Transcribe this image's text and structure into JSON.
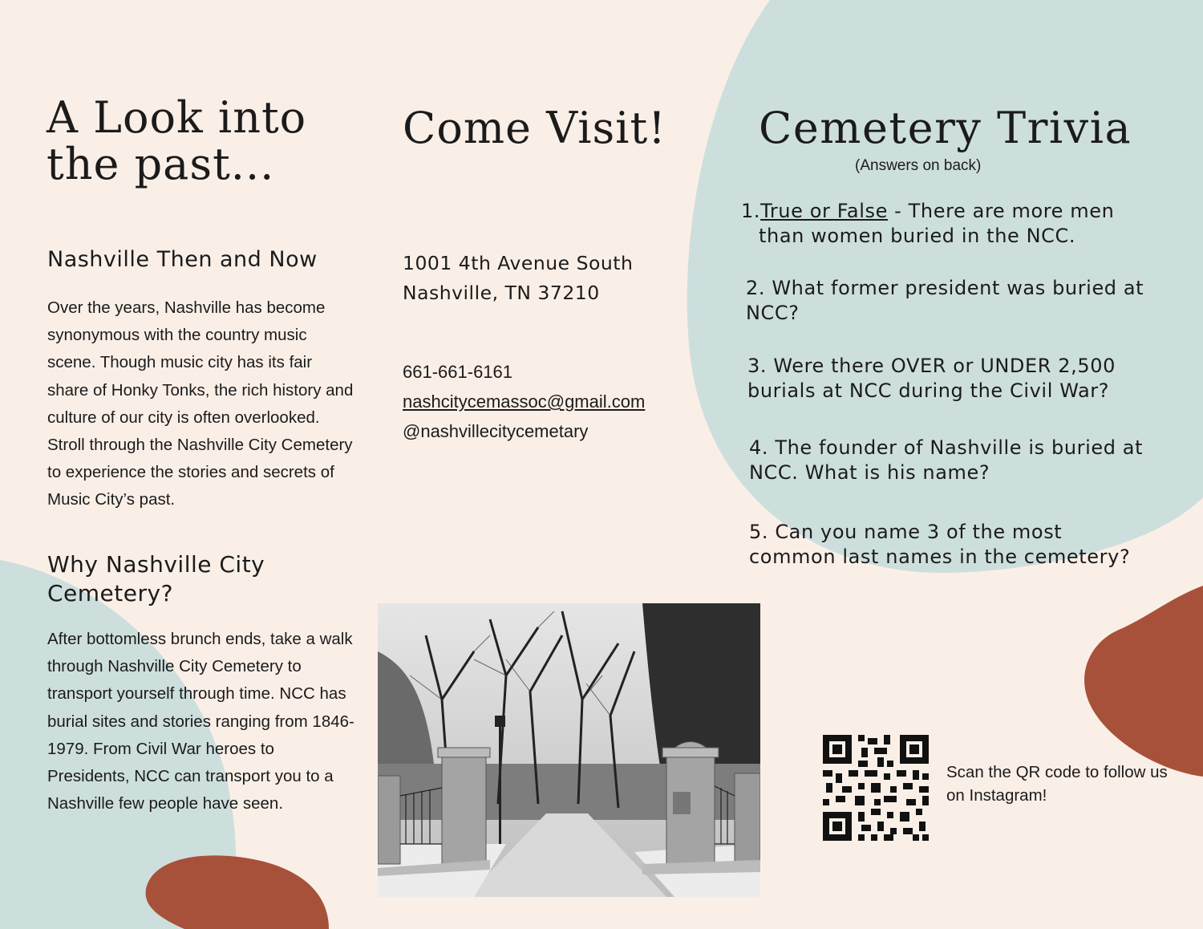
{
  "colors": {
    "background": "#faefe7",
    "blue_blob": "#cddfdd",
    "rust_blob": "#a8513a",
    "text": "#1b1b1b"
  },
  "col1": {
    "title_line1": "A Look into",
    "title_line2": "the past...",
    "heading1": "Nashville Then and Now",
    "para1": "Over the years, Nashville has become synonymous with the country music scene. Though music city has its fair share of Honky Tonks, the rich history and culture of our city is often overlooked. Stroll through the Nashville City Cemetery to experience the stories and secrets of Music City’s past.",
    "heading2": "Why Nashville City Cemetery?",
    "para2": "After bottomless brunch ends, take a walk through Nashville City Cemetery to transport yourself through time. NCC has burial sites and stories ranging from 1846-1979. From Civil War heroes to Presidents, NCC can transport you to a Nashville few people have seen."
  },
  "col2": {
    "title": "Come Visit!",
    "address_line1": "1001 4th Avenue South",
    "address_line2": "Nashville, TN 37210",
    "phone": "661-661-6161",
    "email": "nashcitycemassoc@gmail.com",
    "instagram": "@nashvillecitycemetary"
  },
  "photo": {
    "icon": "cemetery-gate-photo"
  },
  "col3": {
    "title": "Cemetery Trivia",
    "note": "(Answers on back)",
    "q1_num": "1.",
    "q1_underlined": "True or False",
    "q1_rest_line1": " - There are more men",
    "q1_rest_line2": "than women buried in the NCC.",
    "q2": "2. What former president was buried at NCC?",
    "q3": "3. Were there OVER or UNDER 2,500 burials at NCC during the Civil War?",
    "q4": "4. The founder of Nashville is buried at NCC. What is his name?",
    "q5": "5. Can you name 3 of the most common last names in the cemetery?",
    "qr_icon": "qr-code-icon",
    "qr_caption": "Scan the QR code to follow us on Instagram!"
  }
}
